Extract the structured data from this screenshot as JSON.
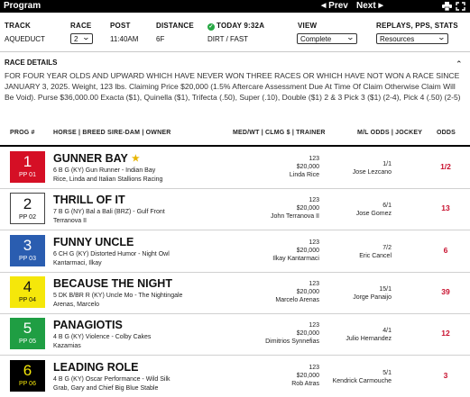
{
  "topbar": {
    "title": "Program",
    "prev_label": "Prev",
    "next_label": "Next"
  },
  "race_header": {
    "track_label": "TRACK",
    "track_value": "AQUEDUCT",
    "race_label": "RACE",
    "race_value": "2",
    "post_label": "POST",
    "post_value": "11:40AM",
    "distance_label": "DISTANCE",
    "distance_value": "6F",
    "today_label": "TODAY 9:32A",
    "surface_value": "DIRT / FAST",
    "view_label": "VIEW",
    "view_value": "Complete",
    "replays_label": "REPLAYS, PPS, STATS",
    "replays_value": "Resources"
  },
  "race_details": {
    "title": "RACE DETAILS",
    "text": "FOR FOUR YEAR OLDS AND UPWARD WHICH HAVE NEVER WON THREE RACES OR WHICH HAVE NOT WON A RACE SINCE JANUARY 3, 2025. Weight, 123 lbs. Claiming Price $20,000 (1.5% Aftercare Assessment Due At Time Of Claim Otherwise Claim Will Be Void). Purse $36,000.00 Exacta ($1), Quinella ($1), Trifecta (.50), Super (.10), Double ($1) 2 & 3 Pick 3 ($1) (2-4), Pick 4 (.50) (2-5)"
  },
  "columns": {
    "prog": "PROG #",
    "horse": "HORSE | BREED SIRE-DAM | OWNER",
    "med": "MED/WT | CLMG $ | TRAINER",
    "ml": "M/L ODDS | JOCKEY",
    "odds": "ODDS"
  },
  "entries": [
    {
      "prog": "1",
      "pp": "PP 01",
      "name": "GUNNER BAY",
      "breed": "6 B G (KY) Gun Runner - Indian Bay",
      "owner": "Rice, Linda and Italian Stallions Racing",
      "weight": "123",
      "claim": "$20,000",
      "trainer": "Linda Rice",
      "ml": "1/1",
      "jockey": "Jose Lezcano",
      "odds": "1/2",
      "bg": "#d50f25",
      "fg": "#ffffff"
    },
    {
      "prog": "2",
      "pp": "PP 02",
      "name": "THRILL OF IT",
      "breed": "7 B G (NY) Bal a Bali (BRZ) - Gulf Front",
      "owner": "Terranova II",
      "weight": "123",
      "claim": "$20,000",
      "trainer": "John Terranova II",
      "ml": "6/1",
      "jockey": "Jose Gomez",
      "odds": "13",
      "bg": "#ffffff",
      "fg": "#111111"
    },
    {
      "prog": "3",
      "pp": "PP 03",
      "name": "FUNNY UNCLE",
      "breed": "6 CH G (KY) Distorted Humor - Night Owl",
      "owner": "Kantarmaci, Ilkay",
      "weight": "123",
      "claim": "$20,000",
      "trainer": "Ilkay Kantarmaci",
      "ml": "7/2",
      "jockey": "Eric Cancel",
      "odds": "6",
      "bg": "#2a5db0",
      "fg": "#ffffff"
    },
    {
      "prog": "4",
      "pp": "PP 04",
      "name": "BECAUSE THE NIGHT",
      "breed": "5 DK B/BR R (KY) Uncle Mo - The Nightingale",
      "owner": "Arenas, Marcelo",
      "weight": "123",
      "claim": "$20,000",
      "trainer": "Marcelo Arenas",
      "ml": "15/1",
      "jockey": "Jorge Panaijo",
      "odds": "39",
      "bg": "#f5e70a",
      "fg": "#111111"
    },
    {
      "prog": "5",
      "pp": "PP 05",
      "name": "PANAGIOTIS",
      "breed": "4 B G (KY) Violence - Colby Cakes",
      "owner": "Kazamias",
      "weight": "123",
      "claim": "$20,000",
      "trainer": "Dimitrios Synnefias",
      "ml": "4/1",
      "jockey": "Julio Hernandez",
      "odds": "12",
      "bg": "#1f9e43",
      "fg": "#ffffff"
    },
    {
      "prog": "6",
      "pp": "PP 06",
      "name": "LEADING ROLE",
      "breed": "4 B G (KY) Oscar Performance - Wild Silk",
      "owner": "Grab, Gary and Chief Big Blue Stable",
      "weight": "123",
      "claim": "$20,000",
      "trainer": "Rob Atras",
      "ml": "5/1",
      "jockey": "Kendrick Carmouche",
      "odds": "3",
      "bg": "#000000",
      "fg": "#f5e70a"
    }
  ],
  "colors": {
    "odds": "#c8102e",
    "star": "#e8b500",
    "check": "#27a844"
  }
}
